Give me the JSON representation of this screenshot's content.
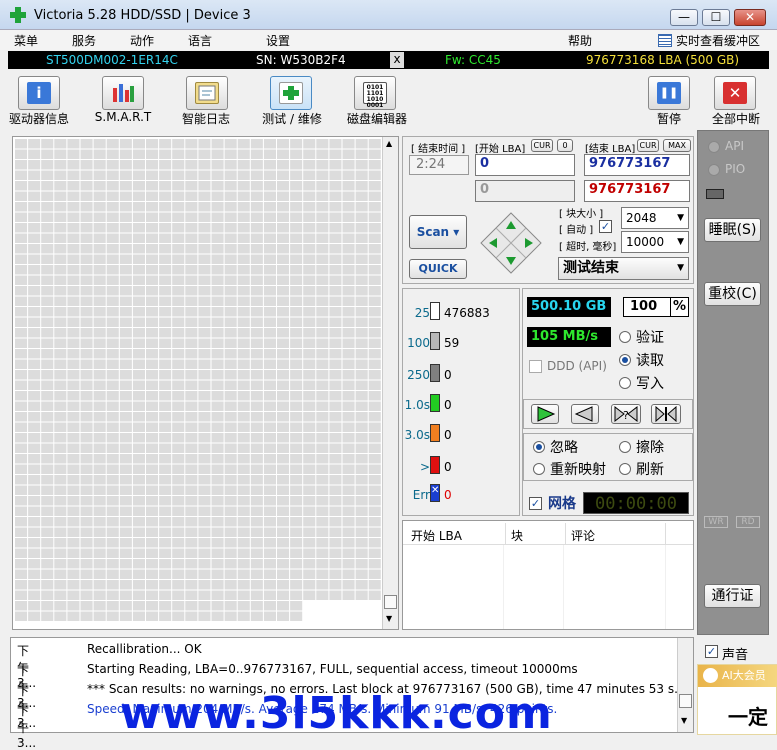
{
  "window": {
    "title": "Victoria 5.28 HDD/SSD | Device 3",
    "min": "—",
    "max": "☐",
    "close": "✕"
  },
  "menu": [
    "菜单",
    "服务",
    "动作",
    "语言",
    "设置",
    "帮助"
  ],
  "menu_right": "实时查看缓冲区",
  "info": {
    "model": "ST500DM002-1ER14C",
    "serial": "SN: W530B2F4",
    "sep": "x",
    "firmware": "Fw: CC45",
    "capacity": "976773168 LBA (500 GB)"
  },
  "toolbar": [
    {
      "name": "drive-info",
      "label": "驱动器信息",
      "icon": "info-icon"
    },
    {
      "name": "smart",
      "label": "S.M.A.R.T",
      "icon": "smart-chart-icon"
    },
    {
      "name": "smart-log",
      "label": "智能日志",
      "icon": "notebook-icon"
    },
    {
      "name": "test-repair",
      "label": "测试 / 维修",
      "icon": "medkit-icon"
    },
    {
      "name": "disk-editor",
      "label": "磁盘编辑器",
      "icon": "binary-icon"
    },
    {
      "name": "pause",
      "label": "暂停",
      "icon": "pause-icon"
    },
    {
      "name": "abort-all",
      "label": "全部中断",
      "icon": "stop-icon"
    }
  ],
  "scan": {
    "end_time_label": "[ 结束时间 ]",
    "end_time": "2:24",
    "start_lba_label": "[开始 LBA]",
    "cur": "CUR",
    "zero": "0",
    "end_lba_label": "[结束 LBA]",
    "max": "MAX",
    "start_lba": "0",
    "end_lba": "976773167",
    "start_lba2": "0",
    "end_lba2": "976773167",
    "scan_button": "Scan",
    "quick_button": "QUICK",
    "block_size_label": "[ 块大小 ]",
    "auto_label": "[ 自动 ]",
    "block_size": "2048",
    "timeout_label": "[ 超时, 毫秒]",
    "timeout": "10000",
    "status": "测试结束"
  },
  "legend": [
    {
      "label": "25",
      "value": "476883",
      "color": "#ffffff"
    },
    {
      "label": "100",
      "value": "59",
      "color": "#b8b8b8"
    },
    {
      "label": "250",
      "value": "0",
      "color": "#808080"
    },
    {
      "label": "1.0s",
      "value": "0",
      "color": "#22cc22"
    },
    {
      "label": "3.0s",
      "value": "0",
      "color": "#f07f20"
    },
    {
      "label": ">",
      "value": "0",
      "color": "#e01010"
    },
    {
      "label": "Err",
      "value": "0",
      "color": "#1a3fd0"
    }
  ],
  "stats": {
    "size": "500.10 GB",
    "percent": "100",
    "percent_sign": "%",
    "speed": "105 MB/s",
    "ddd": "DDD (API)"
  },
  "modes": {
    "verify": "验证",
    "read": "读取",
    "write": "写入"
  },
  "actions": {
    "ignore": "忽略",
    "erase": "擦除",
    "remap": "重新映射",
    "refresh": "刷新"
  },
  "grid_label": "网格",
  "timer": "00:00:00",
  "table": {
    "headers": [
      "开始 LBA",
      "块",
      "评论"
    ]
  },
  "right_panel": {
    "api": "API",
    "pio": "PIO",
    "sleep": "睡眠(S)",
    "recalibrate": "重校(C)",
    "wr": "WR",
    "rd": "RD",
    "passport": "通行证",
    "sound": "声音"
  },
  "log": [
    {
      "time": "下午 3...",
      "msg": "Recallibration... OK"
    },
    {
      "time": "下午 3...",
      "msg": "Starting Reading, LBA=0..976773167, FULL, sequential access, timeout 10000ms"
    },
    {
      "time": "下午 3...",
      "msg": "*** Scan results: no warnings, no errors. Last block at 976773167 (500 GB), time 47 minutes 53 s..."
    },
    {
      "time": "下午 3...",
      "msg": "Speed: Maximum 204 MB/s. Average 174 MB/s. Minimum 91 MB/s. 426 points."
    }
  ],
  "watermark": "www.3l5kkk.com",
  "popup": {
    "line1": "AI大会员",
    "line2": "一定"
  }
}
